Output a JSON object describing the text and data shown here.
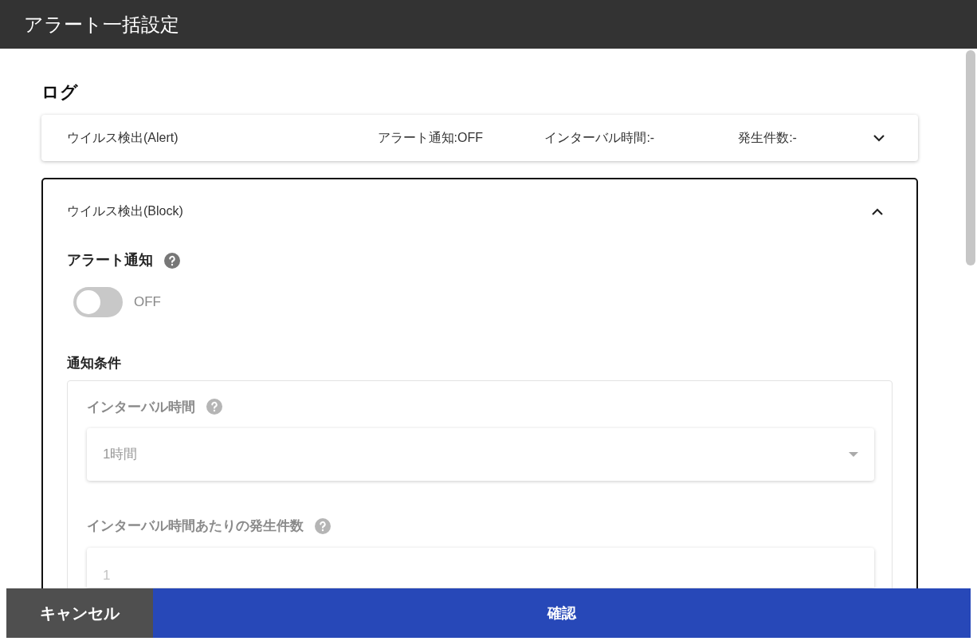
{
  "dialog": {
    "title": "アラート一括設定"
  },
  "section": {
    "title": "ログ"
  },
  "items": [
    {
      "name": "ウイルス検出(Alert)",
      "expanded": false,
      "summary": [
        "アラート通知:OFF",
        "インターバル時間:-",
        "発生件数:-"
      ]
    },
    {
      "name": "ウイルス検出(Block)",
      "expanded": true,
      "alert": {
        "label": "アラート通知",
        "on": false,
        "state_text": "OFF"
      },
      "conditions": {
        "title": "通知条件",
        "disabled": true,
        "interval": {
          "label": "インターバル時間",
          "value": "1時間"
        },
        "count": {
          "label": "インターバル時間あたりの発生件数",
          "value": "1"
        }
      }
    }
  ],
  "footer": {
    "cancel": "キャンセル",
    "confirm": "確認"
  }
}
